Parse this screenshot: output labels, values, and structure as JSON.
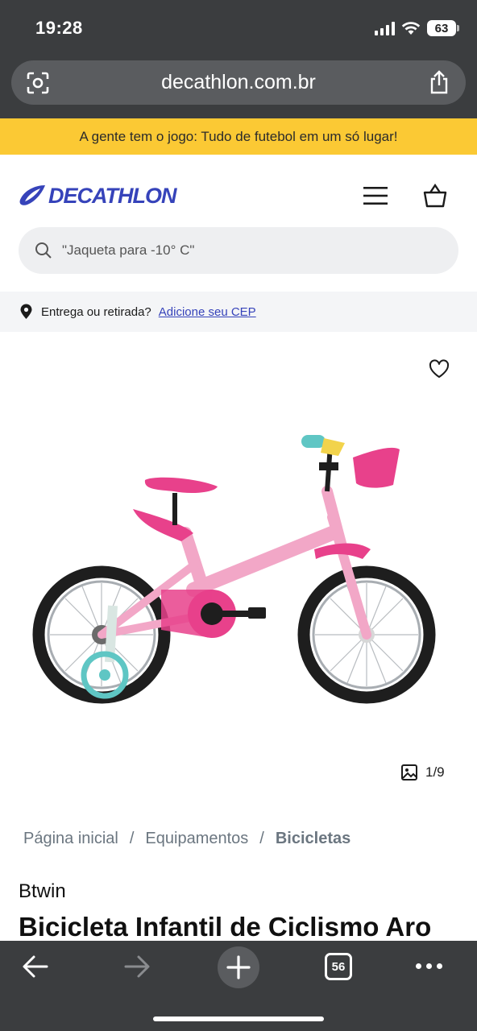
{
  "status_bar": {
    "time": "19:28",
    "battery": "63",
    "icons": [
      "signal-icon",
      "wifi-icon",
      "battery-icon"
    ]
  },
  "browser": {
    "url": "decathlon.com.br",
    "tabs_count": "56",
    "icons": [
      "lens-icon",
      "share-icon",
      "back-icon",
      "forward-icon",
      "new-tab-icon",
      "tabs-icon",
      "more-icon"
    ]
  },
  "promo": {
    "text": "A gente tem o jogo: Tudo de futebol em um só lugar!",
    "color": "#fbc934"
  },
  "header": {
    "logo_text": "DECATHLON",
    "brand_color": "#3643ba",
    "icons": [
      "menu-icon",
      "cart-icon"
    ]
  },
  "search": {
    "placeholder": "\"Jaqueta para -10° C\""
  },
  "delivery": {
    "label": "Entrega ou retirada?",
    "link": "Adicione seu CEP"
  },
  "gallery": {
    "counter": "1/9",
    "icons": [
      "heart-icon",
      "image-icon"
    ]
  },
  "breadcrumb": {
    "items": [
      "Página inicial",
      "Equipamentos",
      "Bicicletas"
    ],
    "separator": "/"
  },
  "product": {
    "brand": "Btwin",
    "title": "Bicicleta Infantil de Ciclismo Aro"
  }
}
